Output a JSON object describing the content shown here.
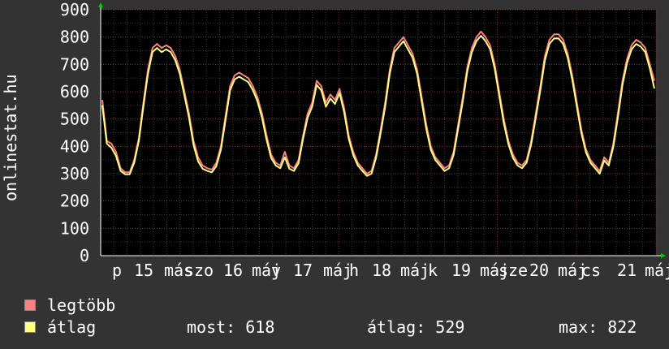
{
  "chart_data": {
    "type": "line",
    "ylabel": "onlinestat.hu",
    "ylim": [
      0,
      900
    ],
    "yticks": [
      0,
      100,
      200,
      300,
      400,
      500,
      600,
      700,
      800,
      900
    ],
    "grid": true,
    "x_tick_labels": [
      "p",
      "15",
      "más",
      "szo",
      "16",
      "máj",
      "v",
      "17",
      "máj",
      "h",
      "18",
      "máj",
      "k",
      "19",
      "máj",
      "sze",
      "20",
      "máj",
      "cs",
      "21",
      "máj"
    ],
    "series": [
      {
        "name": "legtöbb",
        "color": "#ff8080",
        "values": [
          570,
          420,
          410,
          380,
          320,
          305,
          305,
          350,
          430,
          560,
          680,
          760,
          775,
          760,
          770,
          760,
          730,
          680,
          600,
          520,
          420,
          360,
          330,
          320,
          315,
          340,
          400,
          510,
          620,
          660,
          670,
          660,
          650,
          620,
          580,
          520,
          440,
          370,
          340,
          330,
          380,
          330,
          320,
          350,
          440,
          520,
          560,
          640,
          620,
          560,
          590,
          570,
          610,
          540,
          440,
          380,
          340,
          320,
          300,
          310,
          370,
          460,
          560,
          680,
          760,
          780,
          800,
          770,
          740,
          680,
          580,
          480,
          400,
          360,
          340,
          320,
          330,
          380,
          480,
          580,
          690,
          760,
          800,
          820,
          800,
          770,
          700,
          600,
          500,
          420,
          370,
          340,
          330,
          350,
          420,
          520,
          620,
          730,
          790,
          810,
          810,
          790,
          740,
          660,
          560,
          460,
          390,
          350,
          330,
          310,
          360,
          340,
          410,
          520,
          640,
          720,
          770,
          790,
          780,
          760,
          700,
          640
        ]
      },
      {
        "name": "átlag",
        "color": "#ffff80",
        "values": [
          550,
          410,
          395,
          365,
          310,
          298,
          298,
          340,
          420,
          545,
          665,
          745,
          760,
          745,
          755,
          745,
          715,
          665,
          585,
          505,
          405,
          345,
          318,
          310,
          305,
          328,
          388,
          495,
          605,
          645,
          655,
          645,
          635,
          605,
          565,
          505,
          425,
          358,
          330,
          320,
          360,
          318,
          310,
          338,
          428,
          505,
          545,
          625,
          605,
          545,
          575,
          555,
          595,
          525,
          428,
          368,
          330,
          310,
          292,
          300,
          358,
          448,
          545,
          665,
          745,
          765,
          785,
          755,
          725,
          665,
          565,
          465,
          388,
          350,
          330,
          310,
          320,
          368,
          465,
          565,
          675,
          745,
          785,
          805,
          785,
          755,
          685,
          585,
          485,
          408,
          358,
          330,
          320,
          340,
          408,
          505,
          605,
          715,
          775,
          795,
          795,
          775,
          725,
          645,
          545,
          448,
          378,
          340,
          320,
          300,
          348,
          330,
          398,
          505,
          625,
          705,
          755,
          775,
          765,
          745,
          685,
          612
        ]
      }
    ]
  },
  "stats": {
    "current_label": "most:",
    "current_value": "618",
    "avg_label": "átlag:",
    "avg_value": "529",
    "max_label": "max:",
    "max_value": "822"
  }
}
